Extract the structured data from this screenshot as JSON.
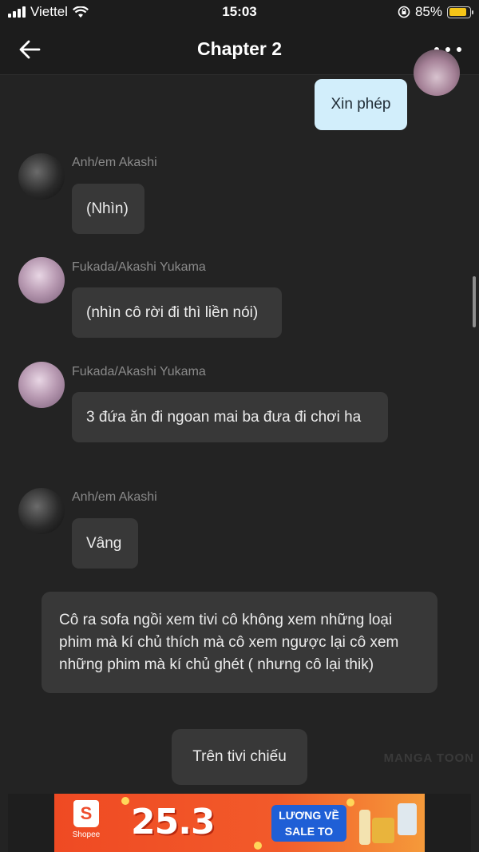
{
  "status_bar": {
    "carrier": "Viettel",
    "time": "15:03",
    "battery_percent": "85%"
  },
  "header": {
    "title": "Chapter 2"
  },
  "messages": [
    {
      "sender": "",
      "text": "Xin phép",
      "side": "right"
    },
    {
      "sender": "Anh/em Akashi",
      "text": "(Nhìn)",
      "side": "left"
    },
    {
      "sender": "Fukada/Akashi Yukama",
      "text": "(nhìn cô rời đi thì liền nói)",
      "side": "left"
    },
    {
      "sender": "Fukada/Akashi Yukama",
      "text": "3 đứa ăn đi ngoan mai ba đưa đi chơi ha",
      "side": "left"
    },
    {
      "sender": "Anh/em Akashi",
      "text": "Vâng",
      "side": "left"
    }
  ],
  "narration": [
    "Cô ra sofa ngồi xem tivi cô không xem những loại",
    "phim mà kí chủ thích mà cô xem ngược lại cô xem",
    "những phim mà kí chủ ghét ( nhưng cô lại thik)"
  ],
  "center_message": "Trên tivi chiếu",
  "watermark": "MANGA TOON",
  "ad": {
    "brand": "Shopee",
    "logo_letter": "S",
    "headline": "25.3",
    "promo_line1": "LƯƠNG VỀ",
    "promo_line2": "SALE TO"
  },
  "colors": {
    "background": "#232323",
    "bubble": "#383838",
    "my_bubble": "#d2eefb",
    "sender_name": "#8a8a8a",
    "ad_accent": "#ee4d2d"
  }
}
